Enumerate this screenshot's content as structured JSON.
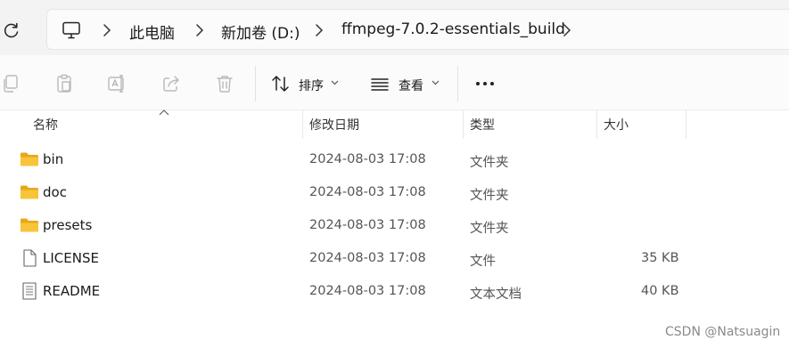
{
  "breadcrumb": {
    "items": [
      "此电脑",
      "新加卷 (D:)",
      "ffmpeg-7.0.2-essentials_build"
    ]
  },
  "toolbar": {
    "sort_label": "排序",
    "view_label": "查看"
  },
  "columns": {
    "name": "名称",
    "modified": "修改日期",
    "type": "类型",
    "size": "大小"
  },
  "files": [
    {
      "name": "bin",
      "modified": "2024-08-03 17:08",
      "type": "文件夹",
      "size": "",
      "icon": "folder-icon"
    },
    {
      "name": "doc",
      "modified": "2024-08-03 17:08",
      "type": "文件夹",
      "size": "",
      "icon": "folder-icon"
    },
    {
      "name": "presets",
      "modified": "2024-08-03 17:08",
      "type": "文件夹",
      "size": "",
      "icon": "folder-icon"
    },
    {
      "name": "LICENSE",
      "modified": "2024-08-03 17:08",
      "type": "文件",
      "size": "35 KB",
      "icon": "file-icon"
    },
    {
      "name": "README",
      "modified": "2024-08-03 17:08",
      "type": "文本文档",
      "size": "40 KB",
      "icon": "text-document-icon"
    }
  ],
  "watermark": "CSDN @Natsuagin",
  "colors": {
    "folder": "#f8c43a",
    "folder_dark": "#e6a817",
    "accent": "#0067c0"
  }
}
